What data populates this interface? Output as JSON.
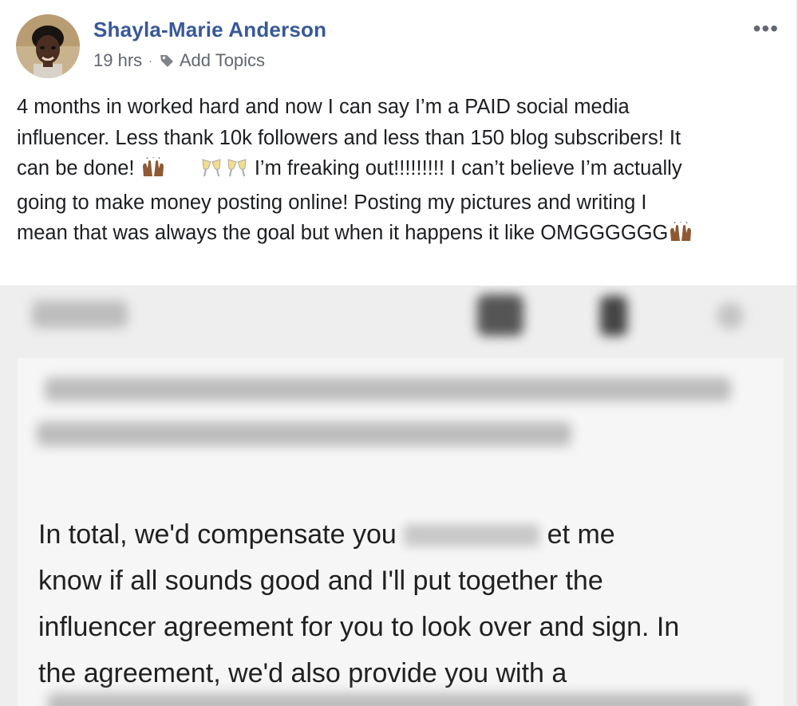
{
  "post": {
    "author": "Shayla-Marie Anderson",
    "time": "19 hrs",
    "separator": "·",
    "topics_label": "Add Topics",
    "more_label": "•••",
    "text_lines": [
      "4 months in worked hard and now I can say I’m a PAID social media",
      "influencer. Less thank 10k followers and less than 150 blog subscribers! It",
      "can be done!",
      "I’m freaking out!!!!!!!!! I can’t believe I’m actually",
      "going to make money posting online! Posting my pictures and writing I",
      "mean that was always the goal but when it happens it like OMGGGGGG"
    ]
  },
  "photo": {
    "receipt_lines": [
      "In total, we'd compensate you",
      "et me",
      "know if all sounds good and I'll put together the",
      "influencer agreement for you to look over and sign. In",
      "the agreement, we'd also provide you with a"
    ]
  },
  "colors": {
    "author": "#385898",
    "meta": "#616770",
    "text": "#1c1e21"
  }
}
